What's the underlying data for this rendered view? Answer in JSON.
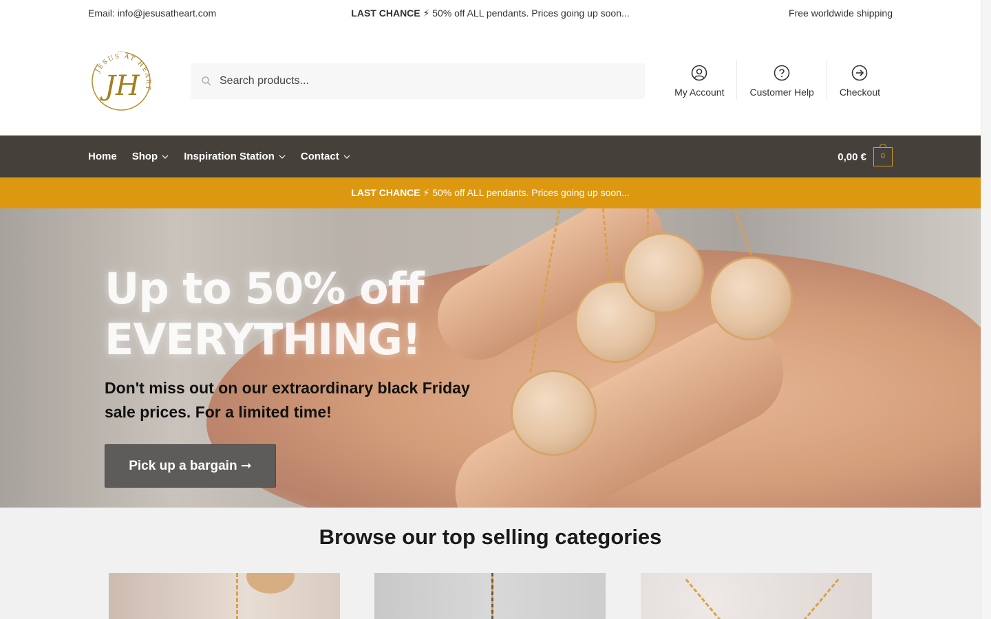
{
  "topbar": {
    "email": "Email: info@jesusatheart.com",
    "promo_bold": "LAST CHANCE",
    "promo_rest": " ⚡ 50% off ALL pendants. Prices going up soon...",
    "shipping": "Free worldwide shipping"
  },
  "header": {
    "logo_text": "JESUS AT HEART",
    "logo_initials": "JH",
    "search_placeholder": "Search products...",
    "links": [
      {
        "label": "My Account",
        "icon": "account-icon"
      },
      {
        "label": "Customer Help",
        "icon": "help-icon"
      },
      {
        "label": "Checkout",
        "icon": "checkout-icon"
      }
    ]
  },
  "nav": {
    "items": [
      {
        "label": "Home",
        "has_dropdown": false
      },
      {
        "label": "Shop",
        "has_dropdown": true
      },
      {
        "label": "Inspiration Station",
        "has_dropdown": true
      },
      {
        "label": "Contact",
        "has_dropdown": true
      }
    ],
    "cart_total": "0,00 €",
    "cart_count": "0"
  },
  "strip": {
    "bold": "LAST CHANCE",
    "rest": " ⚡ 50% off ALL pendants. Prices going up soon..."
  },
  "hero": {
    "headline_1": "Up to 50% off",
    "headline_2": "EVERYTHING!",
    "subtitle": "Don't miss out on our extraordinary black Friday sale prices. For a limited time!",
    "cta": "Pick up a bargain ➞"
  },
  "categories": {
    "title": "Browse our top selling categories"
  },
  "colors": {
    "nav_bg": "#46403a",
    "accent": "#dd9812",
    "gold": "#d4a020",
    "cta_bg": "#5e5c5a"
  }
}
